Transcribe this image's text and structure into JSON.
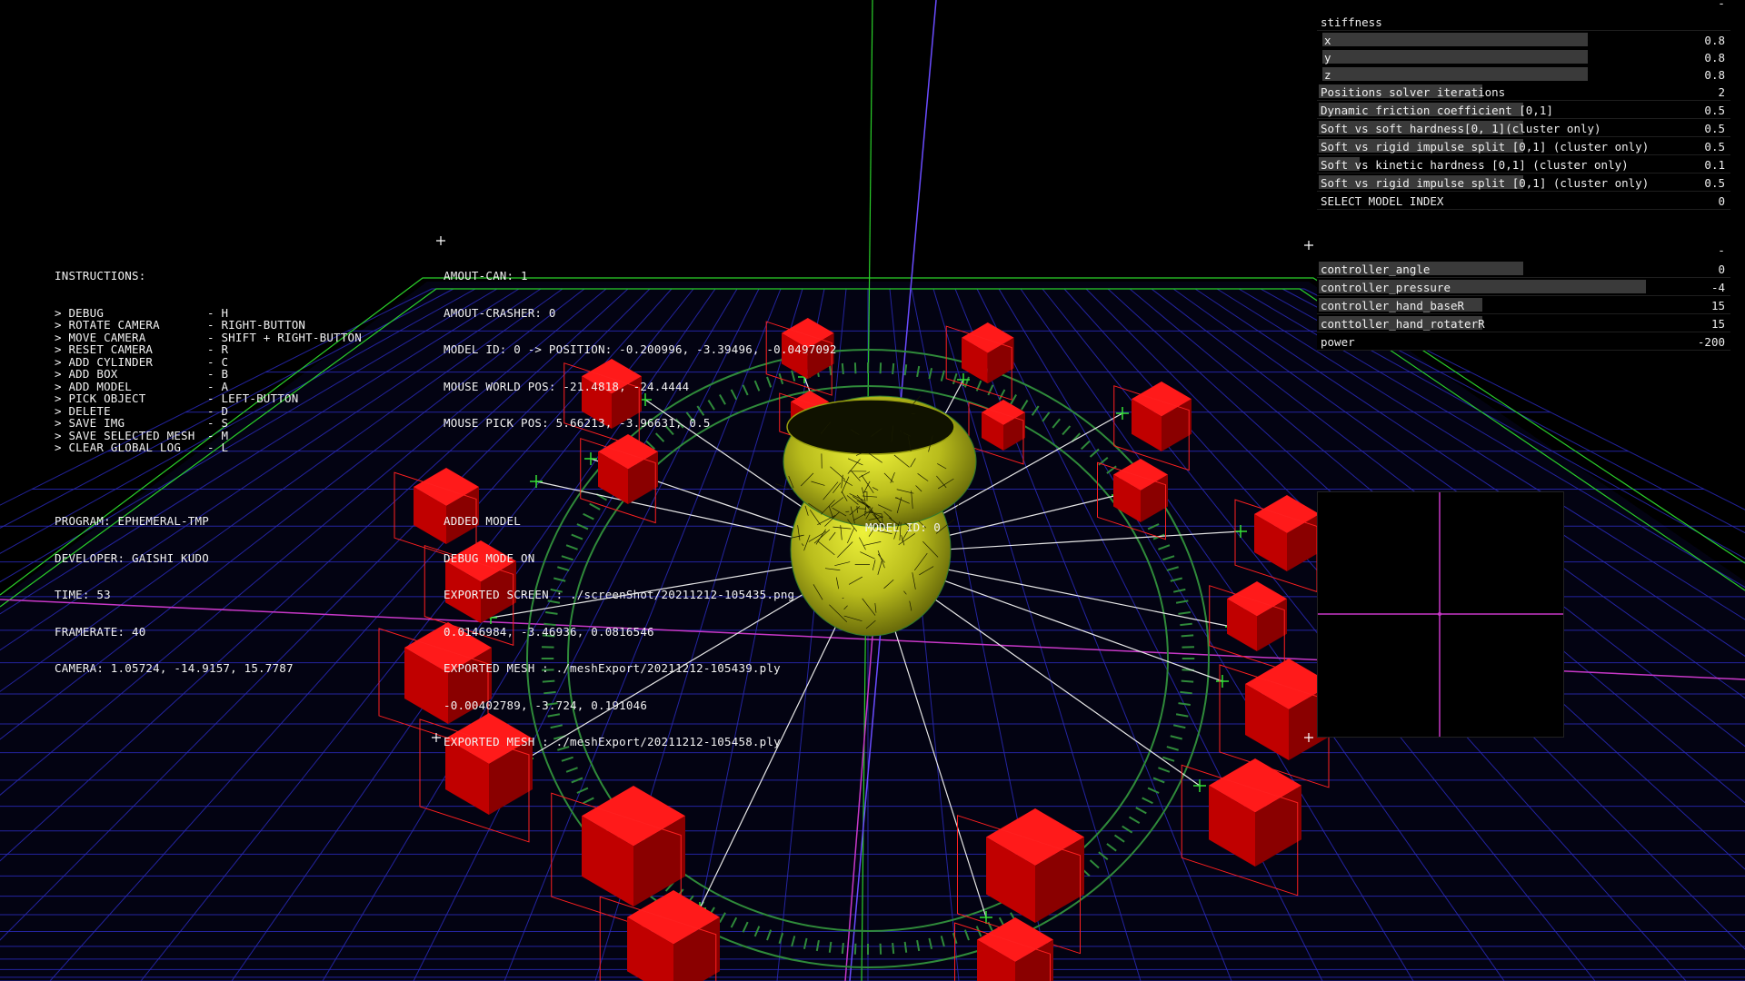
{
  "instructions": {
    "title": "INSTRUCTIONS:",
    "items": [
      {
        "action": "> DEBUG",
        "key": "- H"
      },
      {
        "action": "> ROTATE CAMERA",
        "key": "- RIGHT-BUTTON"
      },
      {
        "action": "> MOVE CAMERA",
        "key": "- SHIFT + RIGHT-BUTTON"
      },
      {
        "action": "> RESET CAMERA",
        "key": "- R"
      },
      {
        "action": "> ADD CYLINDER",
        "key": "- C"
      },
      {
        "action": "> ADD BOX",
        "key": "- B"
      },
      {
        "action": "> ADD MODEL",
        "key": "- A"
      },
      {
        "action": "> PICK OBJECT",
        "key": "- LEFT-BUTTON"
      },
      {
        "action": "> DELETE",
        "key": "- D"
      },
      {
        "action": "> SAVE IMG",
        "key": "- S"
      },
      {
        "action": "> SAVE SELECTED MESH",
        "key": "- M"
      },
      {
        "action": "> CLEAR GLOBAL LOG",
        "key": "- L"
      }
    ]
  },
  "status": [
    "AMOUT-CAN: 1",
    "AMOUT-CRASHER: 0",
    "MODEL ID: 0 -> POSITION: -0.200996, -3.39496, -0.0497092",
    "MOUSE WORLD POS: -21.4818, -24.4444",
    "MOUSE PICK POS: 5.66213, -3.96631, 0.5"
  ],
  "program_info": [
    "PROGRAM: EPHEMERAL-TMP",
    "DEVELOPER: GAISHI KUDO",
    "TIME: 53",
    "FRAMERATE: 40",
    "CAMERA: 1.05724, -14.9157, 15.7787"
  ],
  "log": [
    "ADDED MODEL",
    "DEBUG MODE ON",
    "EXPORTED SCREEN : ./screenShot/20211212-105435.png",
    "0.0146984, -3.46936, 0.0816546",
    "EXPORTED MESH : ./meshExport/20211212-105439.ply",
    "-0.00402789, -3.724, 0.191046",
    "EXPORTED MESH : ./meshExport/20211212-105458.ply"
  ],
  "model_label": "MODEL ID: 0",
  "panel1": {
    "collapse": "-",
    "stiffness_label": "stiffness",
    "stiffness": [
      {
        "label": "x",
        "value": "0.8",
        "fill": 0.8
      },
      {
        "label": "y",
        "value": "0.8",
        "fill": 0.8
      },
      {
        "label": "z",
        "value": "0.8",
        "fill": 0.8
      }
    ],
    "rows": [
      {
        "label": "Positions solver iterations",
        "value": "2",
        "fill": 0.4
      },
      {
        "label": "Dynamic friction coefficient [0,1]",
        "value": "0.5",
        "fill": 0.5
      },
      {
        "label": "Soft vs soft hardness[0, 1](cluster only)",
        "value": "0.5",
        "fill": 0.5
      },
      {
        "label": "Soft vs rigid impulse split [0,1] (cluster only)",
        "value": "0.5",
        "fill": 0.5
      },
      {
        "label": "Soft vs kinetic hardness [0,1] (cluster only)",
        "value": "0.1",
        "fill": 0.1
      },
      {
        "label": "Soft vs rigid impulse split [0,1] (cluster only)",
        "value": "0.5",
        "fill": 0.5
      },
      {
        "label": "SELECT MODEL INDEX",
        "value": "0",
        "fill": 0
      }
    ]
  },
  "panel2": {
    "collapse": "-",
    "rows": [
      {
        "label": "controller_angle",
        "value": "0",
        "fill": 0.5
      },
      {
        "label": "controller_pressure",
        "value": "-4",
        "fill": 0.8
      },
      {
        "label": "controller_hand_baseR",
        "value": "15",
        "fill": 0.4
      },
      {
        "label": "conttoller_hand_rotaterR",
        "value": "15",
        "fill": 0.4
      },
      {
        "label": "power",
        "value": "-200",
        "fill": 0
      }
    ]
  },
  "colors": {
    "grid": "#2a2ab8",
    "grid_major": "#2ad02a",
    "axis_magenta": "#c838c8",
    "box_red": "#e00000",
    "ring_green": "#2f8a3a",
    "model_yellow": "#d6d82a"
  }
}
